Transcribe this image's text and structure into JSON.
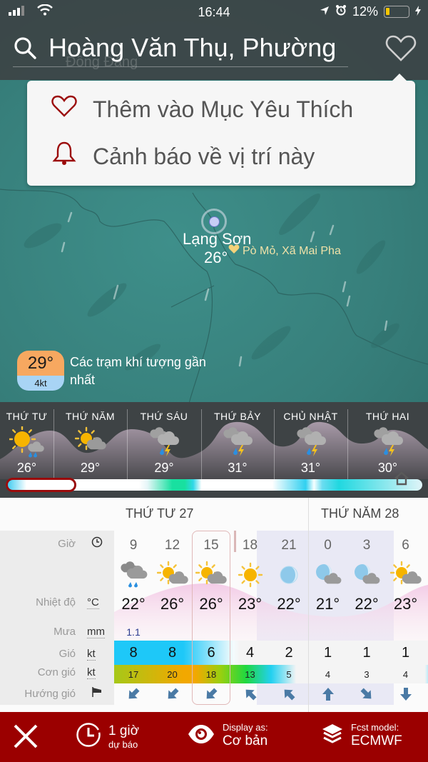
{
  "status_bar": {
    "time": "16:44",
    "battery_percent": "12%",
    "battery_level": 0.12,
    "icons": [
      "signal-icon",
      "wifi-icon",
      "location-arrow-icon",
      "alarm-icon",
      "charging-icon"
    ]
  },
  "search": {
    "value": "Hoàng Văn Thụ, Phường",
    "map_ghost_label": "Đồng Đăng"
  },
  "favorite_menu": {
    "items": [
      {
        "icon": "heart-outline-icon",
        "label": "Thêm vào Mục Yêu Thích"
      },
      {
        "icon": "bell-icon",
        "label": "Cảnh báo về vị trí này"
      }
    ],
    "accent_color": "#9b0b0b"
  },
  "map": {
    "city_name": "Lạng Sơn",
    "city_temp": "26°",
    "poi_label": "Pò Mỏ, Xã Mai Pha",
    "station": {
      "temp": "29°",
      "wind": "4kt",
      "label": "Các trạm khí tượng gần nhất"
    }
  },
  "daily": [
    {
      "name": "THỨ TƯ",
      "temp": "26°",
      "icon": "sun-rain-icon"
    },
    {
      "name": "THỨ NĂM",
      "temp": "29°",
      "icon": "sun-cloud-icon"
    },
    {
      "name": "THỨ SÁU",
      "temp": "29°",
      "icon": "thunderstorm-icon"
    },
    {
      "name": "THỨ BẢY",
      "temp": "31°",
      "icon": "thunderstorm-icon"
    },
    {
      "name": "CHỦ NHẬT",
      "temp": "31°",
      "icon": "thunderstorm-icon"
    },
    {
      "name": "THỨ HAI",
      "temp": "30°",
      "icon": "thunderstorm-icon"
    }
  ],
  "hourly": {
    "day_headers": [
      "THỨ TƯ 27",
      "THỨ NĂM 28"
    ],
    "row_labels": {
      "hour": "Giờ",
      "temp": "Nhiệt độ",
      "temp_unit": "°C",
      "rain": "Mưa",
      "rain_unit": "mm",
      "wind": "Gió",
      "wind_unit": "kt",
      "gust": "Cơn gió",
      "gust_unit": "kt",
      "direction": "Hướng gió"
    },
    "selected_hour": "15",
    "columns": [
      {
        "hour": "9",
        "icon": "rain-cloud-icon",
        "temp": "22°",
        "rain": "1.1",
        "wind": "8",
        "gust": "17",
        "dir": "sw"
      },
      {
        "hour": "12",
        "icon": "sun-cloud-icon",
        "temp": "26°",
        "rain": "",
        "wind": "8",
        "gust": "20",
        "dir": "sw"
      },
      {
        "hour": "15",
        "icon": "sun-cloud-icon",
        "temp": "26°",
        "rain": "",
        "wind": "6",
        "gust": "18",
        "dir": "sw"
      },
      {
        "hour": "18",
        "icon": "sun-icon",
        "temp": "23°",
        "rain": "",
        "wind": "4",
        "gust": "13",
        "dir": "nw"
      },
      {
        "hour": "21",
        "icon": "moon-icon",
        "temp": "22°",
        "rain": "",
        "wind": "2",
        "gust": "5",
        "dir": "nw"
      },
      {
        "hour": "0",
        "icon": "moon-cloud-icon",
        "temp": "21°",
        "rain": "",
        "wind": "1",
        "gust": "4",
        "dir": "n"
      },
      {
        "hour": "3",
        "icon": "moon-cloud-icon",
        "temp": "22°",
        "rain": "",
        "wind": "1",
        "gust": "3",
        "dir": "se"
      },
      {
        "hour": "6",
        "icon": "sun-cloud-icon",
        "temp": "23°",
        "rain": "",
        "wind": "1",
        "gust": "4",
        "dir": "s"
      }
    ]
  },
  "bottom_bar": {
    "close_icon": "close-icon",
    "interval_big": "1 giờ",
    "interval_small": "dự báo",
    "display_small": "Display as:",
    "display_big": "Cơ bản",
    "model_small": "Fcst model:",
    "model_big": "ECMWF",
    "color": "#9b0000"
  }
}
